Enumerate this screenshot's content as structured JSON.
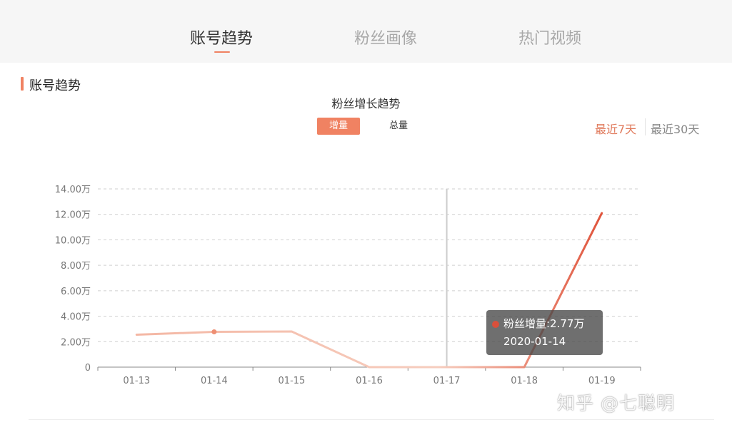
{
  "nav": {
    "tabs": [
      {
        "label": "账号趋势",
        "active": true
      },
      {
        "label": "粉丝画像",
        "active": false
      },
      {
        "label": "热门视频",
        "active": false
      }
    ]
  },
  "section": {
    "title": "账号趋势"
  },
  "controls": {
    "metric_toggle": {
      "active": "增量",
      "inactive": "总量"
    },
    "range": {
      "active": "最近7天",
      "inactive": "最近30天"
    }
  },
  "tooltip": {
    "label": "粉丝增量:2.77万",
    "date": "2020-01-14"
  },
  "watermark": "知乎 @七聪明",
  "colors": {
    "accent": "#f08262",
    "line_start": "#f4b7a4",
    "line_end": "#e0543c"
  },
  "chart_data": {
    "type": "line",
    "title": "粉丝增长趋势",
    "categories": [
      "01-13",
      "01-14",
      "01-15",
      "01-16",
      "01-17",
      "01-18",
      "01-19"
    ],
    "values": [
      2.55,
      2.77,
      2.8,
      0,
      0,
      0,
      12.1
    ],
    "ylim": [
      0,
      14
    ],
    "yticks": [
      0,
      2,
      4,
      6,
      8,
      10,
      12,
      14
    ],
    "ytick_labels": [
      "0",
      "2.00万",
      "4.00万",
      "6.00万",
      "8.00万",
      "10.00万",
      "12.00万",
      "14.00万"
    ],
    "highlight_index": 1,
    "cursor_category": "01-17",
    "grid": true
  }
}
